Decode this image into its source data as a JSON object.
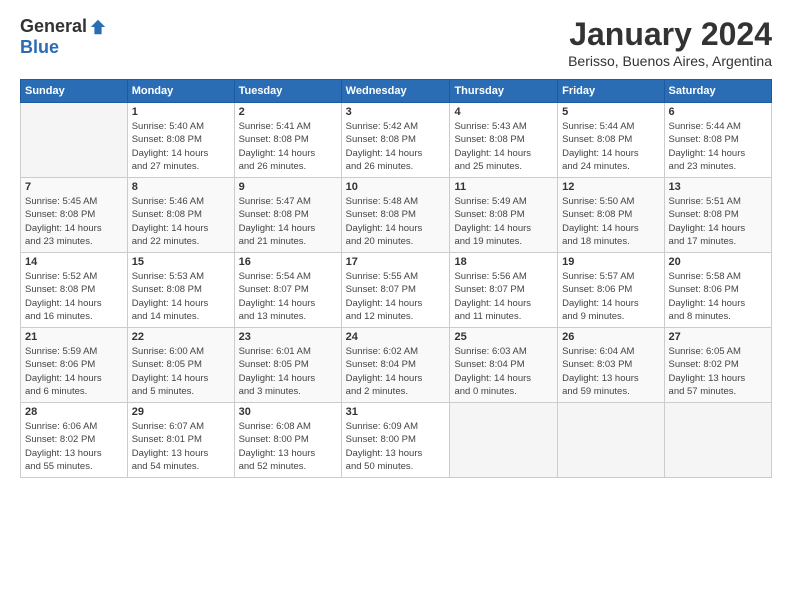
{
  "logo": {
    "general": "General",
    "blue": "Blue"
  },
  "title": "January 2024",
  "location": "Berisso, Buenos Aires, Argentina",
  "days_of_week": [
    "Sunday",
    "Monday",
    "Tuesday",
    "Wednesday",
    "Thursday",
    "Friday",
    "Saturday"
  ],
  "weeks": [
    [
      {
        "day": "",
        "info": ""
      },
      {
        "day": "1",
        "info": "Sunrise: 5:40 AM\nSunset: 8:08 PM\nDaylight: 14 hours\nand 27 minutes."
      },
      {
        "day": "2",
        "info": "Sunrise: 5:41 AM\nSunset: 8:08 PM\nDaylight: 14 hours\nand 26 minutes."
      },
      {
        "day": "3",
        "info": "Sunrise: 5:42 AM\nSunset: 8:08 PM\nDaylight: 14 hours\nand 26 minutes."
      },
      {
        "day": "4",
        "info": "Sunrise: 5:43 AM\nSunset: 8:08 PM\nDaylight: 14 hours\nand 25 minutes."
      },
      {
        "day": "5",
        "info": "Sunrise: 5:44 AM\nSunset: 8:08 PM\nDaylight: 14 hours\nand 24 minutes."
      },
      {
        "day": "6",
        "info": "Sunrise: 5:44 AM\nSunset: 8:08 PM\nDaylight: 14 hours\nand 23 minutes."
      }
    ],
    [
      {
        "day": "7",
        "info": "Sunrise: 5:45 AM\nSunset: 8:08 PM\nDaylight: 14 hours\nand 23 minutes."
      },
      {
        "day": "8",
        "info": "Sunrise: 5:46 AM\nSunset: 8:08 PM\nDaylight: 14 hours\nand 22 minutes."
      },
      {
        "day": "9",
        "info": "Sunrise: 5:47 AM\nSunset: 8:08 PM\nDaylight: 14 hours\nand 21 minutes."
      },
      {
        "day": "10",
        "info": "Sunrise: 5:48 AM\nSunset: 8:08 PM\nDaylight: 14 hours\nand 20 minutes."
      },
      {
        "day": "11",
        "info": "Sunrise: 5:49 AM\nSunset: 8:08 PM\nDaylight: 14 hours\nand 19 minutes."
      },
      {
        "day": "12",
        "info": "Sunrise: 5:50 AM\nSunset: 8:08 PM\nDaylight: 14 hours\nand 18 minutes."
      },
      {
        "day": "13",
        "info": "Sunrise: 5:51 AM\nSunset: 8:08 PM\nDaylight: 14 hours\nand 17 minutes."
      }
    ],
    [
      {
        "day": "14",
        "info": "Sunrise: 5:52 AM\nSunset: 8:08 PM\nDaylight: 14 hours\nand 16 minutes."
      },
      {
        "day": "15",
        "info": "Sunrise: 5:53 AM\nSunset: 8:08 PM\nDaylight: 14 hours\nand 14 minutes."
      },
      {
        "day": "16",
        "info": "Sunrise: 5:54 AM\nSunset: 8:07 PM\nDaylight: 14 hours\nand 13 minutes."
      },
      {
        "day": "17",
        "info": "Sunrise: 5:55 AM\nSunset: 8:07 PM\nDaylight: 14 hours\nand 12 minutes."
      },
      {
        "day": "18",
        "info": "Sunrise: 5:56 AM\nSunset: 8:07 PM\nDaylight: 14 hours\nand 11 minutes."
      },
      {
        "day": "19",
        "info": "Sunrise: 5:57 AM\nSunset: 8:06 PM\nDaylight: 14 hours\nand 9 minutes."
      },
      {
        "day": "20",
        "info": "Sunrise: 5:58 AM\nSunset: 8:06 PM\nDaylight: 14 hours\nand 8 minutes."
      }
    ],
    [
      {
        "day": "21",
        "info": "Sunrise: 5:59 AM\nSunset: 8:06 PM\nDaylight: 14 hours\nand 6 minutes."
      },
      {
        "day": "22",
        "info": "Sunrise: 6:00 AM\nSunset: 8:05 PM\nDaylight: 14 hours\nand 5 minutes."
      },
      {
        "day": "23",
        "info": "Sunrise: 6:01 AM\nSunset: 8:05 PM\nDaylight: 14 hours\nand 3 minutes."
      },
      {
        "day": "24",
        "info": "Sunrise: 6:02 AM\nSunset: 8:04 PM\nDaylight: 14 hours\nand 2 minutes."
      },
      {
        "day": "25",
        "info": "Sunrise: 6:03 AM\nSunset: 8:04 PM\nDaylight: 14 hours\nand 0 minutes."
      },
      {
        "day": "26",
        "info": "Sunrise: 6:04 AM\nSunset: 8:03 PM\nDaylight: 13 hours\nand 59 minutes."
      },
      {
        "day": "27",
        "info": "Sunrise: 6:05 AM\nSunset: 8:02 PM\nDaylight: 13 hours\nand 57 minutes."
      }
    ],
    [
      {
        "day": "28",
        "info": "Sunrise: 6:06 AM\nSunset: 8:02 PM\nDaylight: 13 hours\nand 55 minutes."
      },
      {
        "day": "29",
        "info": "Sunrise: 6:07 AM\nSunset: 8:01 PM\nDaylight: 13 hours\nand 54 minutes."
      },
      {
        "day": "30",
        "info": "Sunrise: 6:08 AM\nSunset: 8:00 PM\nDaylight: 13 hours\nand 52 minutes."
      },
      {
        "day": "31",
        "info": "Sunrise: 6:09 AM\nSunset: 8:00 PM\nDaylight: 13 hours\nand 50 minutes."
      },
      {
        "day": "",
        "info": ""
      },
      {
        "day": "",
        "info": ""
      },
      {
        "day": "",
        "info": ""
      }
    ]
  ]
}
